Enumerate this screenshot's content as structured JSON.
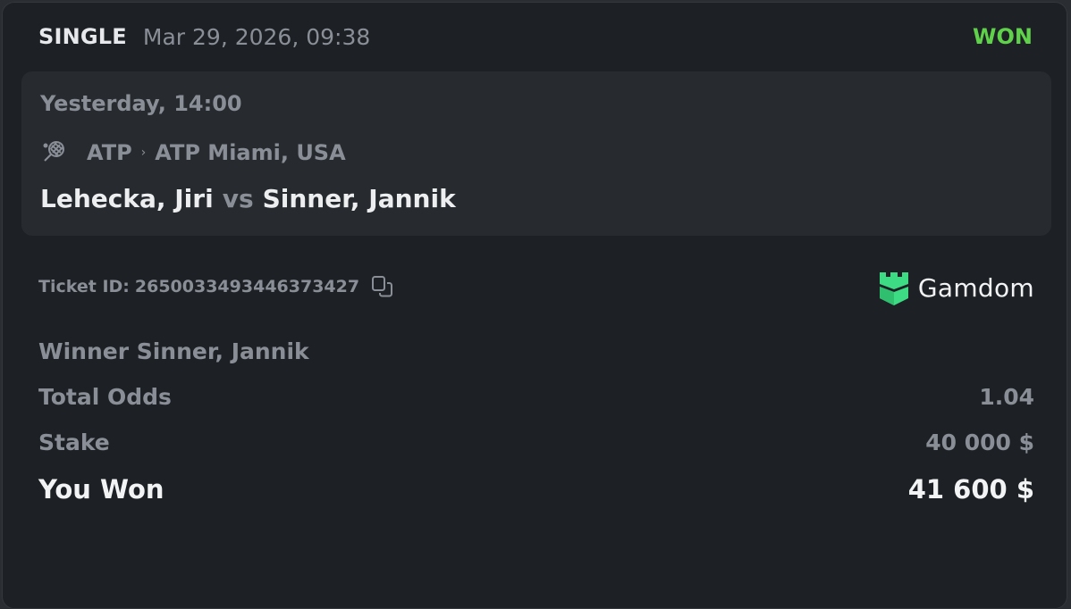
{
  "header": {
    "bet_type": "SINGLE",
    "date": "Mar 29, 2026, 09:38",
    "status": "WON",
    "status_color": "#5fd14a"
  },
  "event": {
    "time": "Yesterday, 14:00",
    "sport_icon": "tennis-racket-icon",
    "league": "ATP",
    "separator": "›",
    "tournament": "ATP Miami, USA",
    "home_team": "Lehecka, Jiri",
    "vs": "vs",
    "away_team": "Sinner, Jannik"
  },
  "ticket": {
    "label": "Ticket ID:",
    "id": "2650033493446373427",
    "copy_icon": "copy-icon"
  },
  "brand": {
    "name": "Gamdom",
    "logo_icon": "gamdom-castle-logo",
    "logo_color": "#3ddc84"
  },
  "selection": "Winner Sinner, Jannik",
  "summary": {
    "odds_label": "Total Odds",
    "odds_value": "1.04",
    "stake_label": "Stake",
    "stake_value": "40 000 $",
    "won_label": "You Won",
    "won_value": "41 600 $"
  }
}
